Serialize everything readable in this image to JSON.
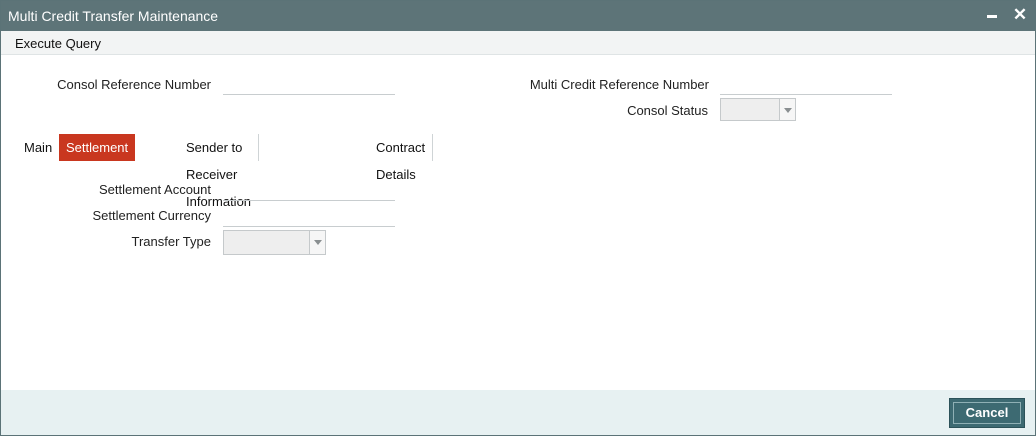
{
  "window": {
    "title": "Multi Credit Transfer Maintenance"
  },
  "toolbar": {
    "execute_query": "Execute Query"
  },
  "header_form": {
    "consol_ref_label": "Consol Reference Number",
    "consol_ref_value": "",
    "multi_credit_ref_label": "Multi Credit Reference Number",
    "multi_credit_ref_value": "",
    "consol_status_label": "Consol Status",
    "consol_status_value": ""
  },
  "tabs": [
    {
      "label": "Main",
      "active": false
    },
    {
      "label": "Settlement Details",
      "active": true
    },
    {
      "label": "Sender to Receiver Information",
      "active": false
    },
    {
      "label": "Contract Details",
      "active": false
    }
  ],
  "settlement": {
    "account_label": "Settlement Account",
    "account_value": "",
    "currency_label": "Settlement Currency",
    "currency_value": "",
    "transfer_type_label": "Transfer Type",
    "transfer_type_value": ""
  },
  "footer": {
    "cancel_label": "Cancel"
  },
  "colors": {
    "titlebar": "#5d7478",
    "active_tab": "#c9371f",
    "cancel_button": "#3d6a72"
  }
}
